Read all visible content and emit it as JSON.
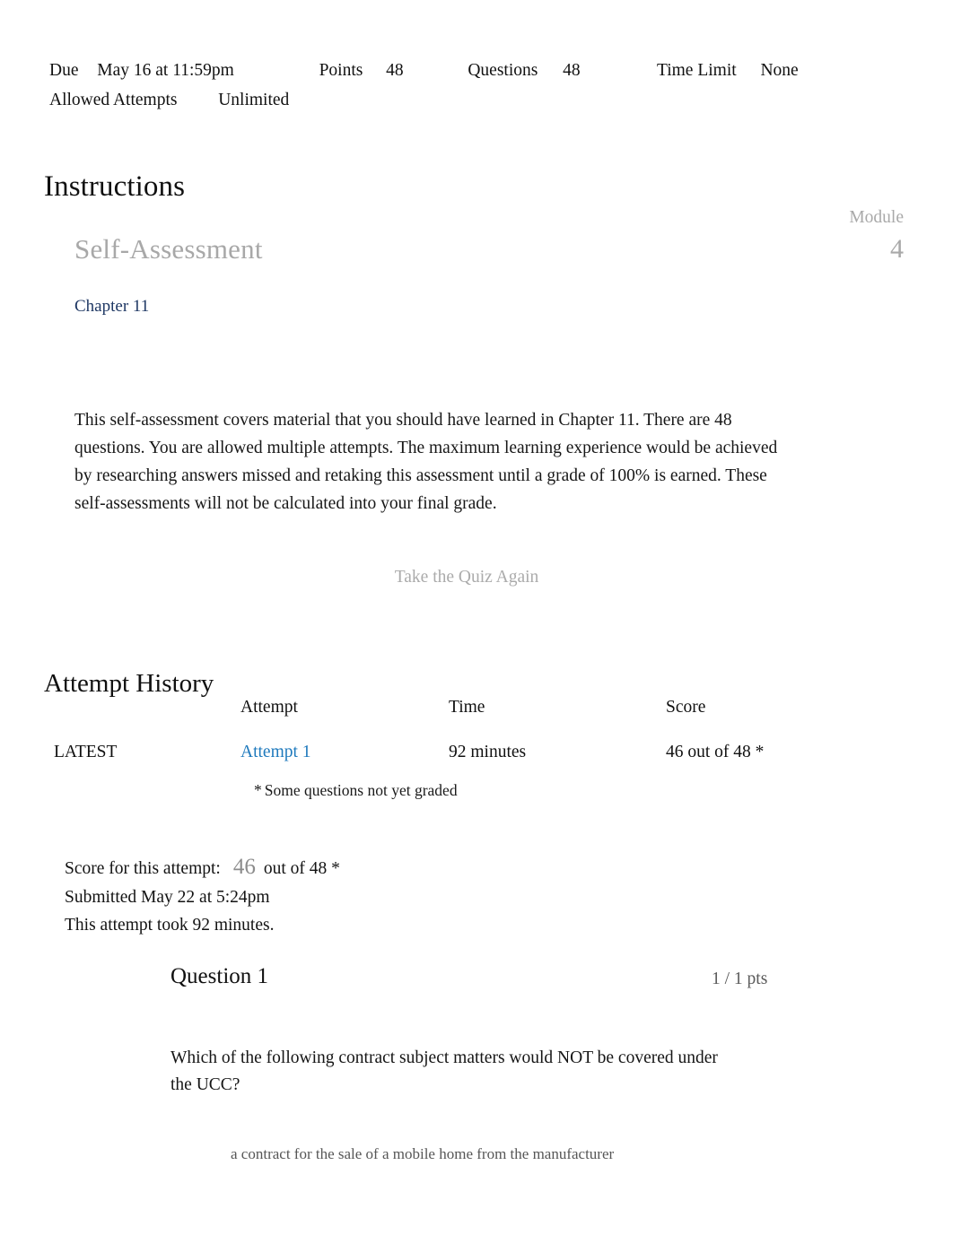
{
  "quiz_meta": {
    "due_label": "Due",
    "due_value": "May 16 at 11:59pm",
    "points_label": "Points",
    "points_value": "48",
    "questions_label": "Questions",
    "questions_value": "48",
    "time_limit_label": "Time Limit",
    "time_limit_value": "None",
    "allowed_attempts_label": "Allowed Attempts",
    "allowed_attempts_value": "Unlimited"
  },
  "instructions": {
    "heading": "Instructions",
    "title": "Self-Assessment",
    "chapter_link": "Chapter 11",
    "module_label": "Module",
    "module_number": "4",
    "body": "This self-assessment covers material that you should have learned in Chapter 11. There are 48 questions. You are allowed multiple attempts. The maximum learning experience would be achieved by researching answers missed and retaking this assessment until a grade of 100% is earned. These self-assessments will not be calculated into your final grade."
  },
  "actions": {
    "take_quiz_again": "Take the Quiz Again"
  },
  "attempt_history": {
    "heading": "Attempt History",
    "columns": {
      "latest": "",
      "attempt": "Attempt",
      "time": "Time",
      "score": "Score"
    },
    "rows": [
      {
        "latest": "LATEST",
        "attempt": "Attempt 1",
        "time": "92 minutes",
        "score": "46 out of 48 *"
      }
    ],
    "note_star": "*",
    "note_text": "Some questions not yet graded"
  },
  "score_summary": {
    "score_label": "Score for this attempt:",
    "score_value": "46",
    "score_out_of": "out of 48 *",
    "submitted": "Submitted May 22 at 5:24pm",
    "duration": "This attempt took 92 minutes."
  },
  "question": {
    "title": "Question 1",
    "points": "1 / 1 pts",
    "text": "Which of the following contract subject matters would NOT be covered under the UCC?",
    "options": [
      "a contract for the sale of a mobile home from the manufacturer"
    ]
  },
  "colors": {
    "link_chapter": "#1f3864",
    "link_attempt": "#1f7abd",
    "muted": "#a9a9a9",
    "background": "#ffffff"
  }
}
